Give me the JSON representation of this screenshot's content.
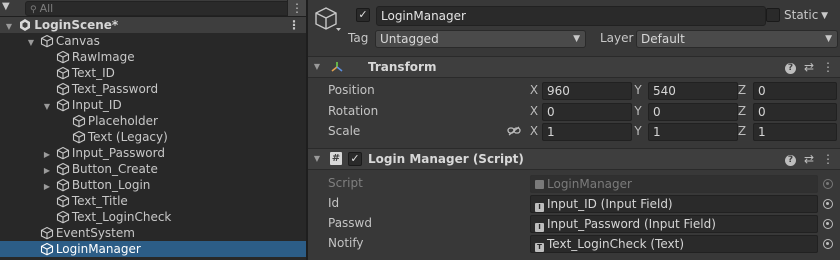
{
  "hierarchy": {
    "search_placeholder": "All",
    "scene_name": "LoginScene*",
    "items": [
      {
        "label": "Canvas"
      },
      {
        "label": "RawImage"
      },
      {
        "label": "Text_ID"
      },
      {
        "label": "Text_Password"
      },
      {
        "label": "Input_ID"
      },
      {
        "label": "Placeholder"
      },
      {
        "label": "Text (Legacy)"
      },
      {
        "label": "Input_Password"
      },
      {
        "label": "Button_Create"
      },
      {
        "label": "Button_Login"
      },
      {
        "label": "Text_Title"
      },
      {
        "label": "Text_LoginCheck"
      },
      {
        "label": "EventSystem"
      },
      {
        "label": "LoginManager"
      }
    ],
    "selected_item": "LoginManager"
  },
  "inspector": {
    "object_name": "LoginManager",
    "active": true,
    "static_label": "Static",
    "static_checked": false,
    "tag_label": "Tag",
    "tag_value": "Untagged",
    "layer_label": "Layer",
    "layer_value": "Default",
    "transform": {
      "title": "Transform",
      "position_label": "Position",
      "rotation_label": "Rotation",
      "scale_label": "Scale",
      "position": {
        "x": "960",
        "y": "540",
        "z": "0"
      },
      "rotation": {
        "x": "0",
        "y": "0",
        "z": "0"
      },
      "scale": {
        "x": "1",
        "y": "1",
        "z": "1"
      },
      "axis_x": "X",
      "axis_y": "Y",
      "axis_z": "Z"
    },
    "script_component": {
      "title": "Login Manager (Script)",
      "enabled": true,
      "script_label": "Script",
      "script_value": "LoginManager",
      "id_label": "Id",
      "id_value": "Input_ID (Input Field)",
      "passwd_label": "Passwd",
      "passwd_value": "Input_Password (Input Field)",
      "notify_label": "Notify",
      "notify_value": "Text_LoginCheck (Text)"
    }
  },
  "colors": {
    "selection": "#2c5d87",
    "panel_bg": "#383838",
    "hierarchy_bg": "#282828",
    "field_bg": "#2a2a2a",
    "transform_icon": "#e0a050"
  }
}
